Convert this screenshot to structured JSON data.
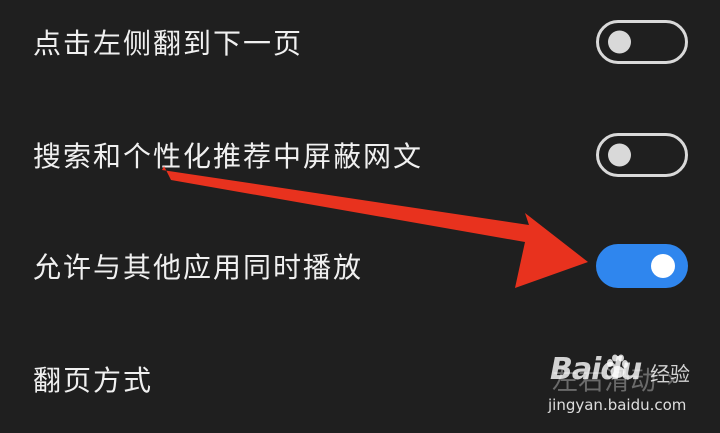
{
  "settings": {
    "items": [
      {
        "label": "点击左侧翻到下一页",
        "toggle": "off"
      },
      {
        "label": "搜索和个性化推荐中屏蔽网文",
        "toggle": "off"
      },
      {
        "label": "允许与其他应用同时播放",
        "toggle": "on"
      },
      {
        "label": "翻页方式",
        "value": "左右滑动",
        "chevron": "›"
      }
    ]
  },
  "watermark": {
    "brand": "Baidu",
    "product": "经验",
    "url": "jingyan.baidu.com"
  },
  "annotation": {
    "arrow_color": "#e8321e"
  },
  "colors": {
    "background": "#1f1f1f",
    "toggle_on": "#2f86ee",
    "toggle_off": "#d9d9d9",
    "text": "#f0f0f0"
  }
}
